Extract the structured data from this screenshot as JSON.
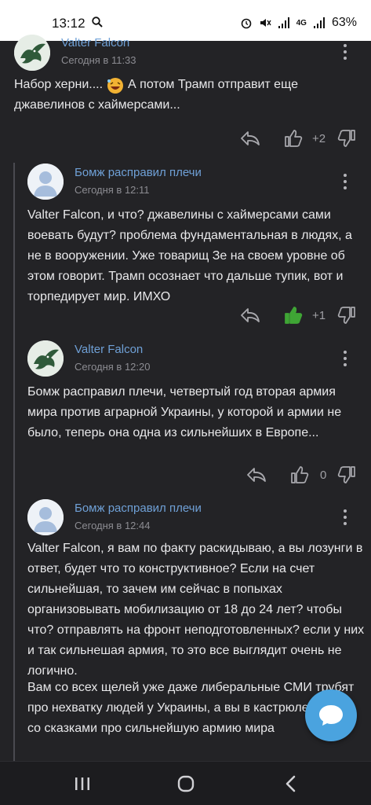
{
  "status_bar": {
    "time": "13:12",
    "battery": "63%",
    "network": "4G",
    "icons": [
      "search-icon",
      "alarm-icon",
      "mute-icon",
      "signal-icon",
      "signal-icon",
      "battery-icon"
    ]
  },
  "comments": [
    {
      "author": "Valter Falcon",
      "date": "Сегодня в 11:33",
      "avatar": "eagle-avatar",
      "text_parts": [
        "Набор херни....",
        "А потом Трамп отправит еще джавелинов с хаймерсами..."
      ],
      "emoji": "laughing-emoji",
      "rating": "+2",
      "liked": false
    },
    {
      "author": "Бомж расправил плечи",
      "date": "Сегодня в 12:11",
      "avatar": "default-user-avatar",
      "text": "Valter Falcon, и что? джавелины с хаймерсами сами воевать будут? проблема фундаментальная в людях, а не в вооружении. Уже товарищ Зе на своем уровне об этом говорит. Трамп осознает что дальше тупик, вот и торпедирует мир. ИМХО",
      "rating": "+1",
      "liked": true
    },
    {
      "author": "Valter Falcon",
      "date": "Сегодня в 12:20",
      "avatar": "eagle-avatar",
      "text": "Бомж расправил плечи, четвертый год вторая армия мира против аграрной Украины, у которой и армии не было, теперь она одна из сильнейших в Европе...",
      "rating": "0",
      "liked": false
    },
    {
      "author": "Бомж расправил плечи",
      "date": "Сегодня в 12:44",
      "avatar": "default-user-avatar",
      "text": "Valter Falcon, я вам по факту раскидываю, а вы лозунги в ответ, будет что то конструктивное? Если на счет сильнейшая, то зачем им сейчас в попыхах организовывать мобилизацию от 18 до 24 лет? чтобы что? отправлять на фронт неподготовленных? если у них и так сильнешая армия, то это все выглядит очень не логично.",
      "text2": "Вам со всех щелей уже даже либеральные СМИ трубят про нехватку людей у Украины, а вы в кастрюле сидите со сказками про сильнейшую армию мира"
    }
  ],
  "colors": {
    "background": "#232326",
    "author": "#6fa0d6",
    "accent": "#4aa3df",
    "like_active": "#3fa535"
  }
}
